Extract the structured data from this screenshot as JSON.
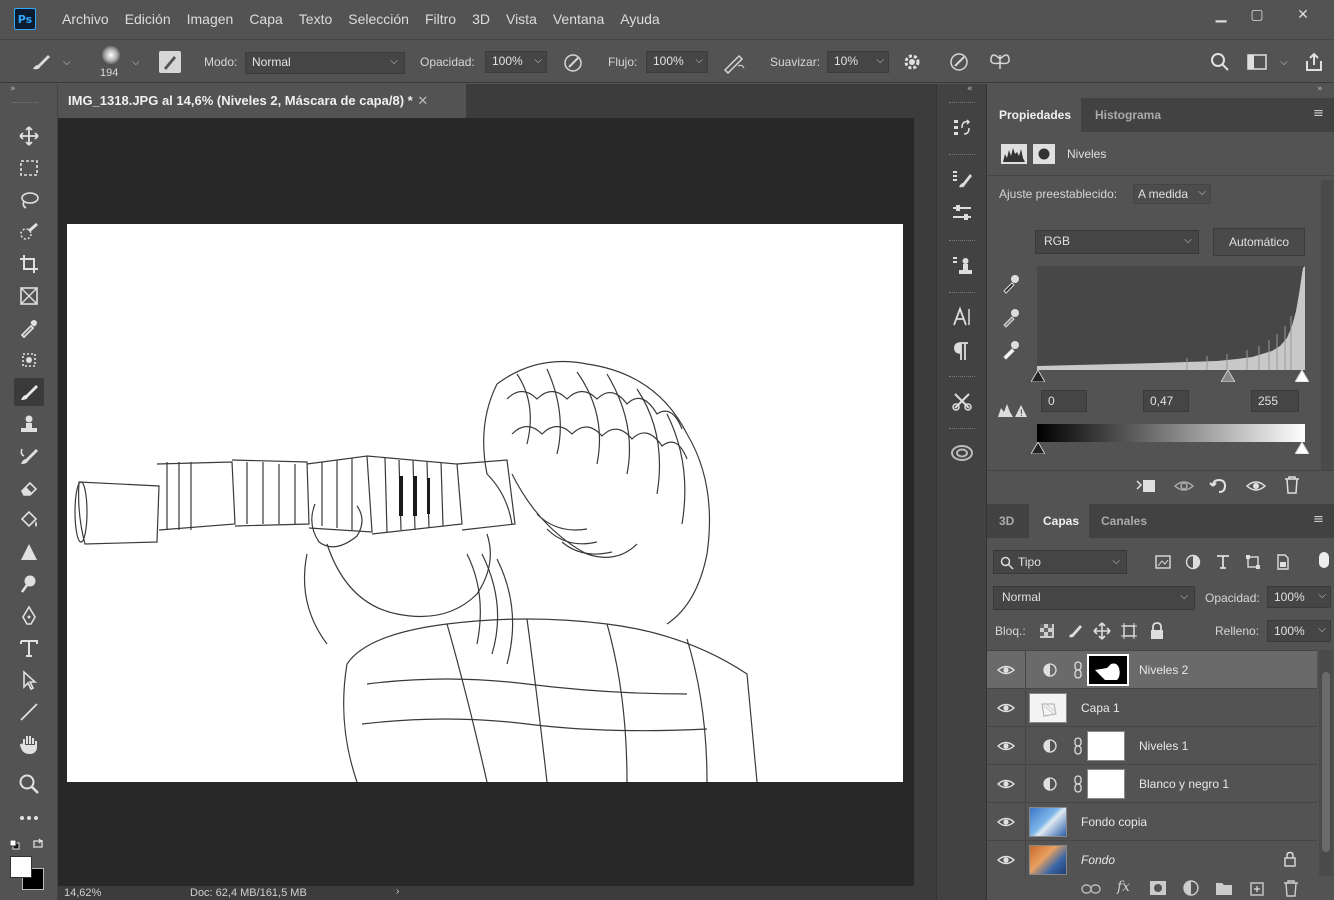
{
  "app": {
    "logo": "Ps"
  },
  "menu": [
    "Archivo",
    "Edición",
    "Imagen",
    "Capa",
    "Texto",
    "Selección",
    "Filtro",
    "3D",
    "Vista",
    "Ventana",
    "Ayuda"
  ],
  "window_controls": {
    "minimize": "▁",
    "maximize": "▢",
    "close": "✕"
  },
  "options": {
    "brush_size": "194",
    "mode_label": "Modo:",
    "mode_value": "Normal",
    "opacity_label": "Opacidad:",
    "opacity_value": "100%",
    "flow_label": "Flujo:",
    "flow_value": "100%",
    "smooth_label": "Suavizar:",
    "smooth_value": "10%"
  },
  "document": {
    "tab_title": "IMG_1318.JPG al 14,6% (Niveles 2, Máscara de capa/8) *",
    "zoom": "14,62%",
    "doc_info": "Doc: 62,4 MB/161,5 MB"
  },
  "properties": {
    "tabs": [
      "Propiedades",
      "Histograma"
    ],
    "active_tab": "Propiedades",
    "adjustment_name": "Niveles",
    "preset_label": "Ajuste preestablecido:",
    "preset_value": "A medida",
    "channel": "RGB",
    "auto_button": "Automático",
    "input_black": "0",
    "input_gamma": "0,47",
    "input_white": "255"
  },
  "layers_panel": {
    "tabs": [
      "3D",
      "Capas",
      "Canales"
    ],
    "active_tab": "Capas",
    "filter_kind": "Tipo",
    "blend_mode": "Normal",
    "opacity_label": "Opacidad:",
    "opacity_value": "100%",
    "lock_label": "Bloq.:",
    "fill_label": "Relleno:",
    "fill_value": "100%",
    "layers": [
      {
        "name": "Niveles 2",
        "selected": true,
        "type": "adjustment-masked"
      },
      {
        "name": "Capa 1",
        "selected": false,
        "type": "pixel"
      },
      {
        "name": "Niveles 1",
        "selected": false,
        "type": "adjustment"
      },
      {
        "name": "Blanco y negro 1",
        "selected": false,
        "type": "adjustment"
      },
      {
        "name": "Fondo copia",
        "selected": false,
        "type": "pixel"
      },
      {
        "name": "Fondo",
        "selected": false,
        "type": "background-locked"
      }
    ]
  },
  "colors": {
    "accent": "#31a8ff",
    "panel_bg": "#535353",
    "canvas_bg": "#282828",
    "selected_layer": "#6a6a6a"
  }
}
